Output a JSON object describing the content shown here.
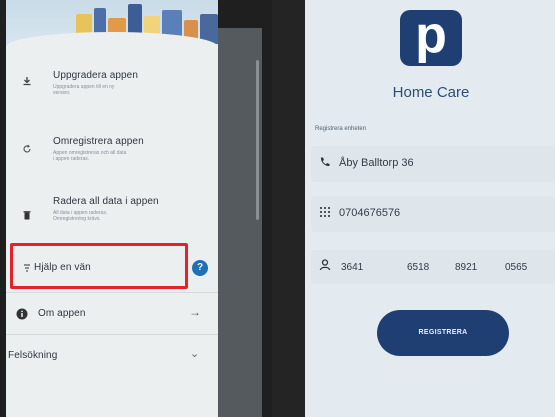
{
  "left_app": {
    "menu": [
      {
        "id": "upgrade",
        "icon": "download-icon",
        "title": "Uppgradera appen",
        "subtitle": "Uppgradera appen till en ny\nversion."
      },
      {
        "id": "reregister",
        "icon": "refresh-icon",
        "title": "Omregistrera appen",
        "subtitle": "Appen omregistreras och all data\ni appen raderas."
      },
      {
        "id": "delete",
        "icon": "trash-icon",
        "title": "Radera all data i appen",
        "subtitle": "All data i appen raderas.\nOmregistrering krävs."
      },
      {
        "id": "help",
        "icon": "filter-icon",
        "title": "Hjälp en vän"
      },
      {
        "id": "about",
        "icon": "info-icon",
        "title": "Om appen"
      },
      {
        "id": "troubleshoot",
        "title": "Felsökning"
      }
    ],
    "help_badge": "?",
    "highlight_color": "#e0242a"
  },
  "right_app": {
    "logo_letter": "p",
    "app_name": "Home Care",
    "section_label": "Registrera enheten",
    "address": "Åby Balltorp 36",
    "phone": "0704676576",
    "code_parts": [
      "3641",
      "6518",
      "8921",
      "0565"
    ],
    "register_button": "REGISTRERA",
    "brand_color": "#1f3f73"
  }
}
